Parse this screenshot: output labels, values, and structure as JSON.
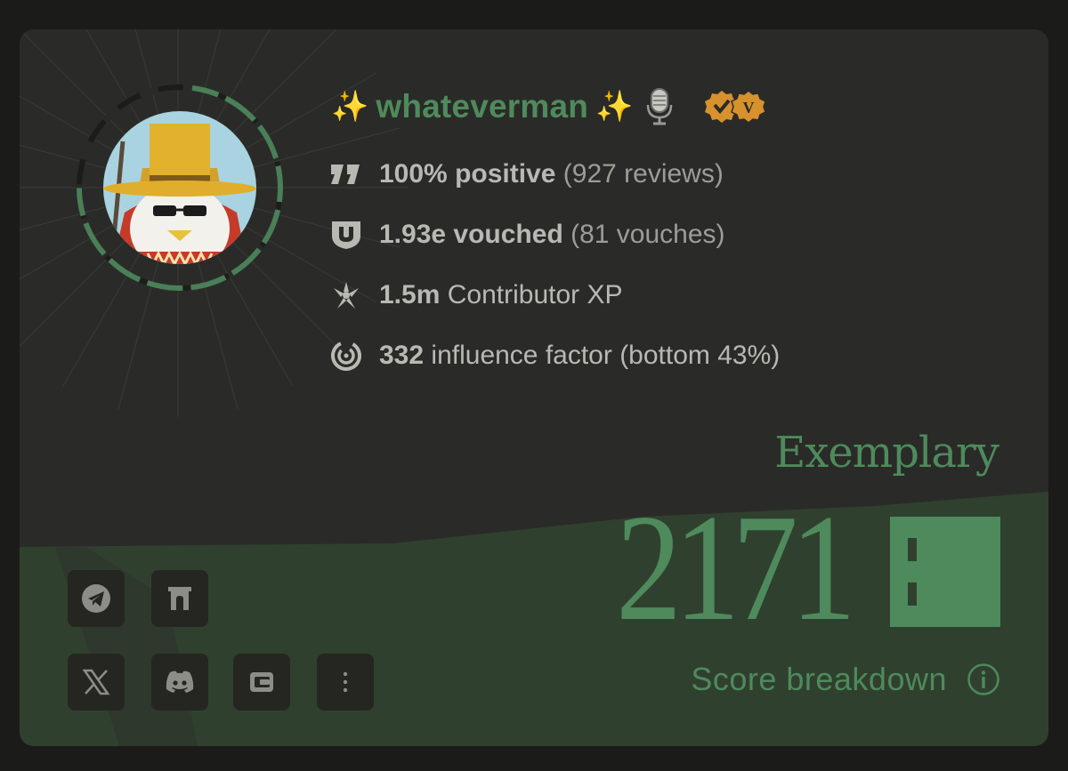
{
  "profile": {
    "name": "whateverman",
    "sparkle_left": "✨",
    "sparkle_right": "✨"
  },
  "stats": {
    "reviews": {
      "value": "100% positive",
      "detail": "(927 reviews)"
    },
    "vouches": {
      "value": "1.93e vouched",
      "detail": "(81 vouches)"
    },
    "xp": {
      "value": "1.5m",
      "label": "Contributor XP"
    },
    "influence": {
      "value": "332",
      "label": "influence factor (bottom 43%)"
    }
  },
  "score": {
    "level": "Exemplary",
    "value": "2171",
    "breakdown_label": "Score breakdown"
  },
  "icons": {
    "reviews": "reviews-icon",
    "vouches": "vouch-shield-icon",
    "xp": "contributor-xp-icon",
    "influence": "influence-icon",
    "mic": "microphone-icon",
    "badge": "verified-badge-icon",
    "info": "info-icon"
  },
  "social_buttons": [
    "telegram-icon",
    "farcaster-icon",
    "x-icon",
    "discord-icon",
    "wallet-icon",
    "more-options-icon"
  ],
  "colors": {
    "accent": "#4e8a5c",
    "card": "#2a2b28",
    "band": "#30402f",
    "page": "#1b1c1a",
    "text": "#b9b9b3",
    "badge": "#d7912d"
  }
}
